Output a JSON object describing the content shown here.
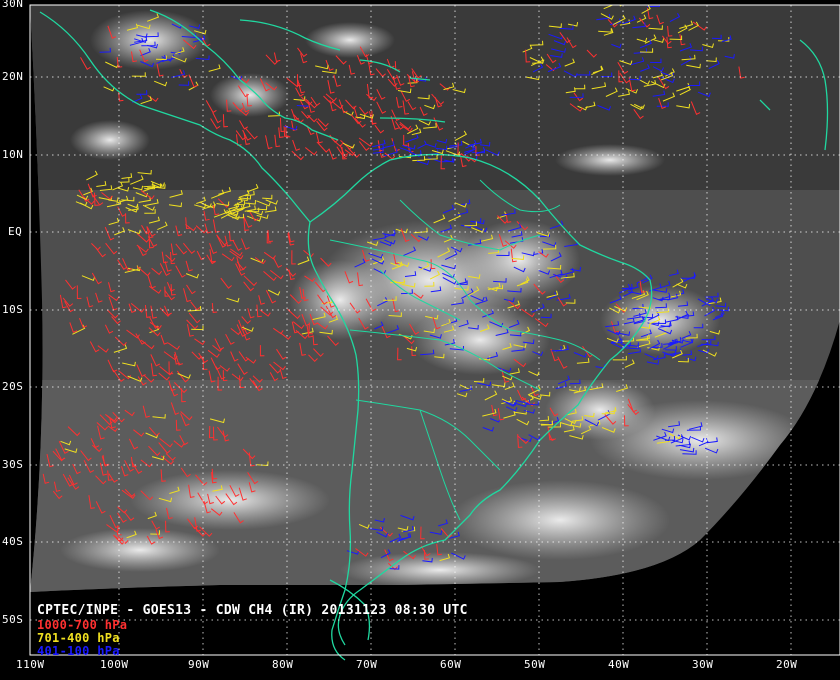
{
  "caption": "CPTEC/INPE - GOES13 - CDW CH4 (IR) 20131123 08:30 UTC",
  "legend": [
    {
      "label": "1000-700 hPa",
      "color": "#ff3030"
    },
    {
      "label": "701-400 hPa",
      "color": "#f0e020"
    },
    {
      "label": "401-100 hPa",
      "color": "#1a1aff"
    }
  ],
  "latitude_labels": [
    "30N",
    "20N",
    "10N",
    "EQ",
    "10S",
    "20S",
    "30S",
    "40S",
    "50S"
  ],
  "longitude_labels": [
    "110W",
    "100W",
    "90W",
    "80W",
    "70W",
    "60W",
    "50W",
    "40W",
    "30W",
    "20W"
  ],
  "colors": {
    "coastline": "#20d8a0",
    "gridline": "#ffffff",
    "background": "#000000",
    "satellite_gray": "#505050"
  }
}
